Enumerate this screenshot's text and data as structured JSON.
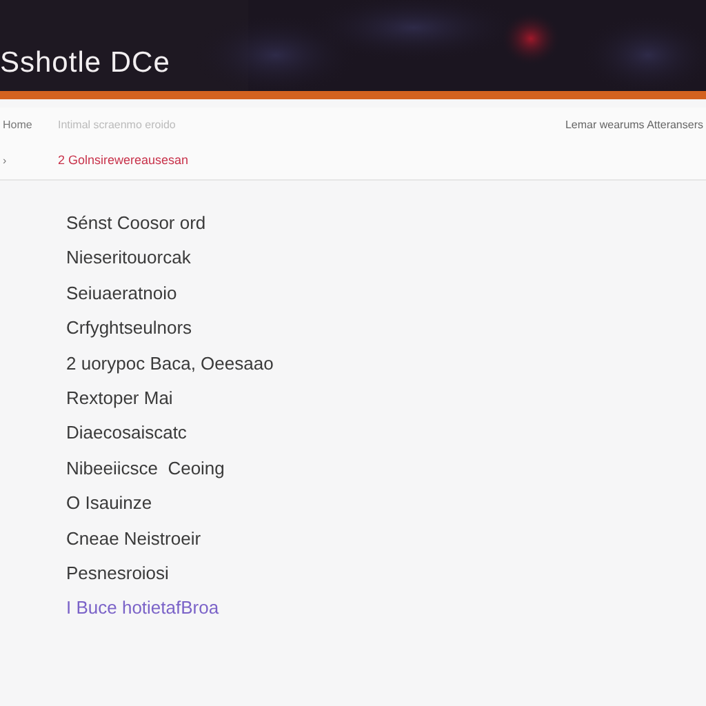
{
  "header": {
    "title": "Sshotle DCe"
  },
  "nav": {
    "left": "Home",
    "middle": "Intimal scraenmo eroido",
    "right": "Lemar wearums Atteransers"
  },
  "sub_nav": {
    "left": "›",
    "link": "2 Golnsirewereausesan"
  },
  "items": [
    {
      "label": "Sénst Coosor ord",
      "highlighted": false
    },
    {
      "label": "Nieseritouorcak",
      "highlighted": false
    },
    {
      "label": "Seiuaeratnoio",
      "highlighted": false
    },
    {
      "label": "Crfyghtseulnors",
      "highlighted": false
    },
    {
      "label": "2 uorypoc Baca, Oeesaao",
      "highlighted": false
    },
    {
      "label": "Rextoper Mai",
      "highlighted": false
    },
    {
      "label": "Diaecosaiscatc",
      "highlighted": false
    },
    {
      "label": "Nibeeiicsce  Ceoing",
      "highlighted": false
    },
    {
      "label": "O Isauinze",
      "highlighted": false
    },
    {
      "label": "Cneae Neistroeir",
      "highlighted": false
    },
    {
      "label": "Pesnesroiosi",
      "highlighted": false
    },
    {
      "label": "I Buce hotietafBroa",
      "highlighted": true
    }
  ]
}
